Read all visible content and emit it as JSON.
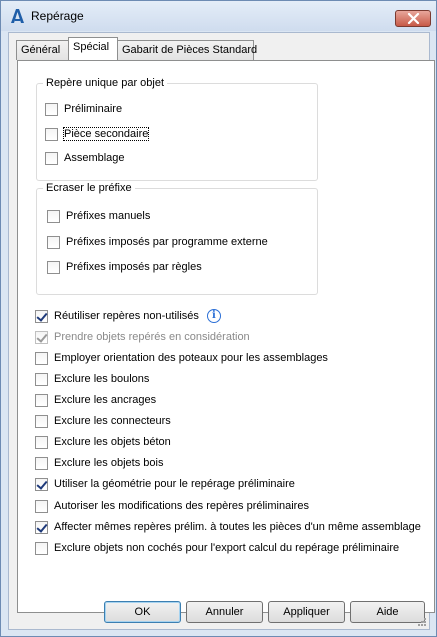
{
  "window": {
    "title": "Repérage",
    "icon": "autodesk-a-icon",
    "close_icon": "close-icon"
  },
  "tabs": [
    {
      "label": "Général",
      "active": false
    },
    {
      "label": "Spécial",
      "active": true
    },
    {
      "label": "Gabarit de Pièces Standard",
      "active": false
    }
  ],
  "group_unique": {
    "title": "Repère unique par objet",
    "items": [
      {
        "label": "Préliminaire",
        "checked": false
      },
      {
        "label": "Pièce secondaire",
        "checked": false
      },
      {
        "label": "Assemblage",
        "checked": false
      }
    ]
  },
  "group_prefix": {
    "title": "Ecraser le préfixe",
    "items": [
      {
        "label": "Préfixes manuels",
        "checked": false
      },
      {
        "label": "Préfixes imposés par programme externe",
        "checked": false
      },
      {
        "label": "Préfixes imposés par règles",
        "checked": false
      }
    ]
  },
  "options": [
    {
      "label": "Réutiliser repères non-utilisés",
      "checked": true,
      "disabled": false
    },
    {
      "label": "Prendre objets repérés en considération",
      "checked": true,
      "disabled": true
    },
    {
      "label": "Employer orientation des poteaux pour les assemblages",
      "checked": false,
      "disabled": false
    },
    {
      "label": "Exclure les boulons",
      "checked": false,
      "disabled": false
    },
    {
      "label": "Exclure les ancrages",
      "checked": false,
      "disabled": false
    },
    {
      "label": "Exclure les connecteurs",
      "checked": false,
      "disabled": false
    },
    {
      "label": "Exclure les objets béton",
      "checked": false,
      "disabled": false
    },
    {
      "label": "Exclure les objets bois",
      "checked": false,
      "disabled": false
    },
    {
      "label": "Utiliser la géométrie pour le repérage préliminaire",
      "checked": true,
      "disabled": false
    },
    {
      "label": "Autoriser les modifications des repères préliminaires",
      "checked": false,
      "disabled": false
    },
    {
      "label": "Affecter mêmes repères prélim. à toutes les pièces d'un même assemblage",
      "checked": true,
      "disabled": false
    },
    {
      "label": "Exclure objets non cochés pour l'export calcul du repérage préliminaire",
      "checked": false,
      "disabled": false
    }
  ],
  "info_icon": "info-icon",
  "buttons": {
    "ok": "OK",
    "cancel": "Annuler",
    "apply": "Appliquer",
    "help": "Aide"
  }
}
